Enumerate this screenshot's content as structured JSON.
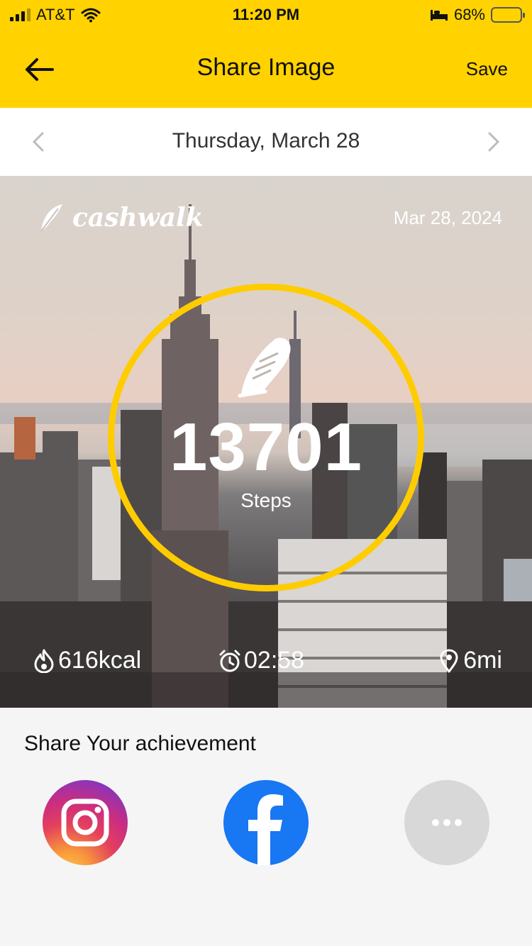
{
  "status": {
    "carrier": "AT&T",
    "time": "11:20 PM",
    "battery": "68%",
    "battery_level": 0.68
  },
  "nav": {
    "title": "Share Image",
    "save_label": "Save"
  },
  "date_bar": {
    "label": "Thursday, March 28"
  },
  "card": {
    "brand": "cashwalk",
    "date": "Mar 28, 2024",
    "steps": "13701",
    "steps_label": "Steps",
    "kcal": "616kcal",
    "duration": "02:58",
    "distance": "6mi"
  },
  "share": {
    "title": "Share Your achievement",
    "targets": [
      "instagram",
      "facebook",
      "more"
    ]
  },
  "colors": {
    "accent": "#FFD200",
    "ring": "#FFCC00",
    "facebook": "#1877F2"
  }
}
